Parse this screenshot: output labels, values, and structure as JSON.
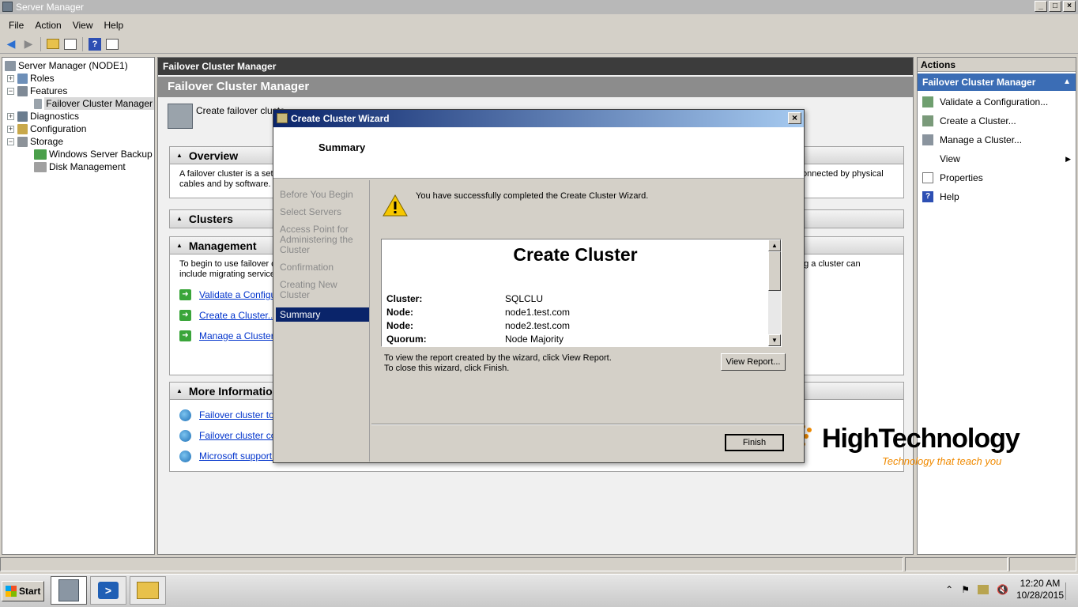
{
  "window": {
    "title": "Server Manager",
    "buttons": [
      "_",
      "□",
      "×"
    ]
  },
  "menu": [
    "File",
    "Action",
    "View",
    "Help"
  ],
  "tree": [
    {
      "label": "Server Manager (NODE1)",
      "level": 0,
      "expander": ""
    },
    {
      "label": "Roles",
      "level": 1,
      "expander": "+"
    },
    {
      "label": "Features",
      "level": 1,
      "expander": "−"
    },
    {
      "label": "Failover Cluster Manager",
      "level": 2,
      "expander": "",
      "selected": true
    },
    {
      "label": "Diagnostics",
      "level": 1,
      "expander": "+"
    },
    {
      "label": "Configuration",
      "level": 1,
      "expander": "+"
    },
    {
      "label": "Storage",
      "level": 1,
      "expander": "−"
    },
    {
      "label": "Windows Server Backup",
      "level": 2,
      "expander": ""
    },
    {
      "label": "Disk Management",
      "level": 2,
      "expander": ""
    }
  ],
  "center": {
    "header": "Failover Cluster Manager",
    "title": "Failover Cluster Manager",
    "intro": "Create failover cluste",
    "overview": {
      "title": "Overview",
      "text_left": "A failover cluster is a set",
      "text_left2": "cables and by software.",
      "text_right": "onnected by physical"
    },
    "clusters": {
      "title": "Clusters"
    },
    "management": {
      "title": "Management",
      "text_left": "To begin to use failover c",
      "text_left2": "include migrating service",
      "text_right": "ng a cluster can",
      "links": [
        "Validate a Configura",
        "Create a Cluster...",
        "Manage a Cluster..."
      ]
    },
    "more_info": {
      "title": "More Informatio",
      "links": [
        "Failover cluster topic",
        "Failover cluster com",
        "Microsoft support pa"
      ]
    }
  },
  "actions": {
    "header": "Actions",
    "subheader": "Failover Cluster Manager",
    "items": [
      {
        "label": "Validate a Configuration...",
        "icon": "validate-icon"
      },
      {
        "label": "Create a Cluster...",
        "icon": "create-cluster-icon"
      },
      {
        "label": "Manage a Cluster...",
        "icon": "manage-cluster-icon"
      },
      {
        "label": "View",
        "icon": "",
        "submenu": true
      },
      {
        "label": "Properties",
        "icon": "properties-icon"
      },
      {
        "label": "Help",
        "icon": "help-icon"
      }
    ]
  },
  "dialog": {
    "title": "Create Cluster Wizard",
    "page_title": "Summary",
    "steps": [
      "Before You Begin",
      "Select Servers",
      "Access Point for Administering the Cluster",
      "Confirmation",
      "Creating New Cluster",
      "Summary"
    ],
    "current_step": 5,
    "success": "You have successfully completed the Create Cluster Wizard.",
    "report": {
      "title": "Create Cluster",
      "rows": [
        {
          "label": "Cluster:",
          "value": "SQLCLU"
        },
        {
          "label": "Node:",
          "value": "node1.test.com"
        },
        {
          "label": "Node:",
          "value": "node2.test.com"
        },
        {
          "label": "Quorum:",
          "value": "Node Majority"
        }
      ]
    },
    "hint1": "To view the report created by the wizard, click View Report.",
    "hint2": "To close this wizard, click Finish.",
    "view_report": "View Report...",
    "finish": "Finish"
  },
  "taskbar": {
    "start": "Start",
    "time": "12:20 AM",
    "date": "10/28/2015"
  },
  "watermark": {
    "name": "HighTechnology",
    "tagline": "Technology that teach you"
  }
}
